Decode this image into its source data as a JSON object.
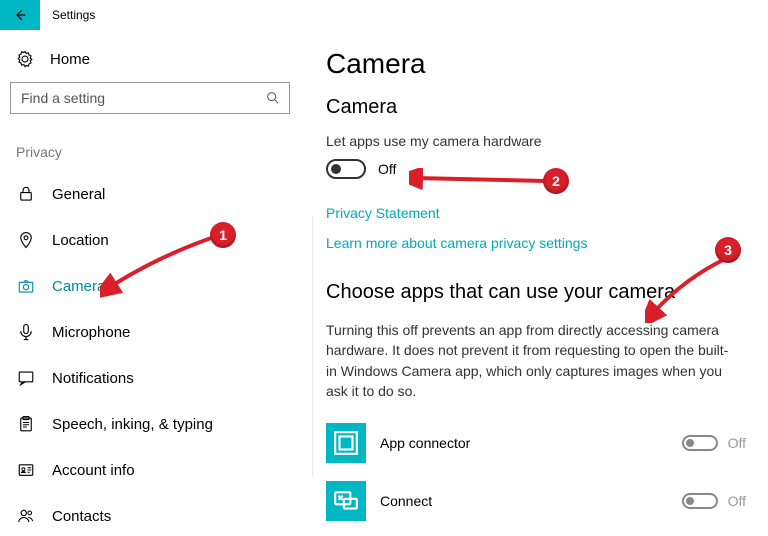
{
  "titlebar": {
    "title": "Settings"
  },
  "sidebar": {
    "home": "Home",
    "search_placeholder": "Find a setting",
    "section": "Privacy",
    "items": [
      {
        "label": "General"
      },
      {
        "label": "Location"
      },
      {
        "label": "Camera"
      },
      {
        "label": "Microphone"
      },
      {
        "label": "Notifications"
      },
      {
        "label": "Speech, inking, & typing"
      },
      {
        "label": "Account info"
      },
      {
        "label": "Contacts"
      }
    ]
  },
  "main": {
    "h1": "Camera",
    "h2": "Camera",
    "toggle_intro": "Let apps use my camera hardware",
    "toggle_state": "Off",
    "link_privacy": "Privacy Statement",
    "link_learn": "Learn more about camera privacy settings",
    "h3": "Choose apps that can use your camera",
    "desc": "Turning this off prevents an app from directly accessing camera hardware. It does not prevent it from requesting to open the built-in Windows Camera app, which only captures images when you ask it to do so.",
    "apps": [
      {
        "name": "App connector",
        "state": "Off"
      },
      {
        "name": "Connect",
        "state": "Off"
      }
    ]
  },
  "annotations": {
    "badge1": "1",
    "badge2": "2",
    "badge3": "3"
  }
}
